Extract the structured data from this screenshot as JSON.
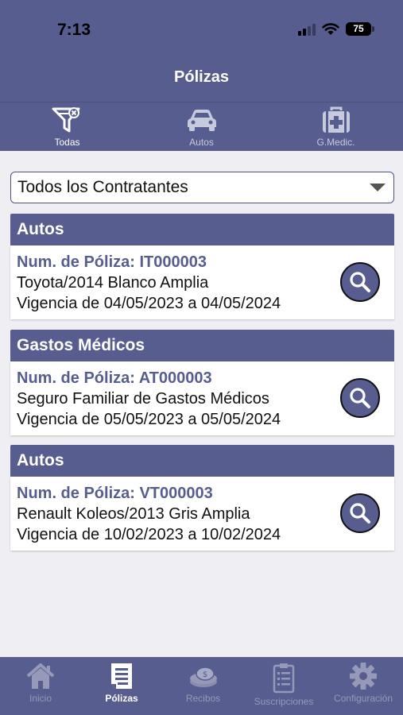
{
  "status_bar": {
    "time": "7:13",
    "battery": "75"
  },
  "header": {
    "title": "Pólizas"
  },
  "top_tabs": [
    {
      "label": "Todas",
      "icon": "filter-icon",
      "active": true
    },
    {
      "label": "Autos",
      "icon": "car-icon",
      "active": false
    },
    {
      "label": "G.Medic.",
      "icon": "medical-kit-icon",
      "active": false
    }
  ],
  "filter": {
    "selected": "Todos los Contratantes"
  },
  "policies": [
    {
      "category": "Autos",
      "number": "Num. de Póliza: IT000003",
      "description": "Toyota/2014 Blanco Amplia",
      "validity": "Vigencia de 04/05/2023 a 04/05/2024"
    },
    {
      "category": "Gastos Médicos",
      "number": "Num. de Póliza: AT000003",
      "description": "Seguro Familiar de Gastos Médicos",
      "validity": "Vigencia de 05/05/2023 a 05/05/2024"
    },
    {
      "category": "Autos",
      "number": "Num. de Póliza: VT000003",
      "description": "Renault Koleos/2013 Gris Amplia",
      "validity": "Vigencia de 10/02/2023 a 10/02/2024"
    }
  ],
  "bottom_nav": [
    {
      "label": "Inicio",
      "icon": "home-icon",
      "active": false
    },
    {
      "label": "Pólizas",
      "icon": "document-icon",
      "active": true
    },
    {
      "label": "Recibos",
      "icon": "coins-icon",
      "active": false
    },
    {
      "label": "Suscripciones",
      "icon": "clipboard-icon",
      "active": false
    },
    {
      "label": "Configuración",
      "icon": "gear-icon",
      "active": false
    }
  ],
  "colors": {
    "primary": "#575d8e",
    "background": "#eeeef3"
  }
}
